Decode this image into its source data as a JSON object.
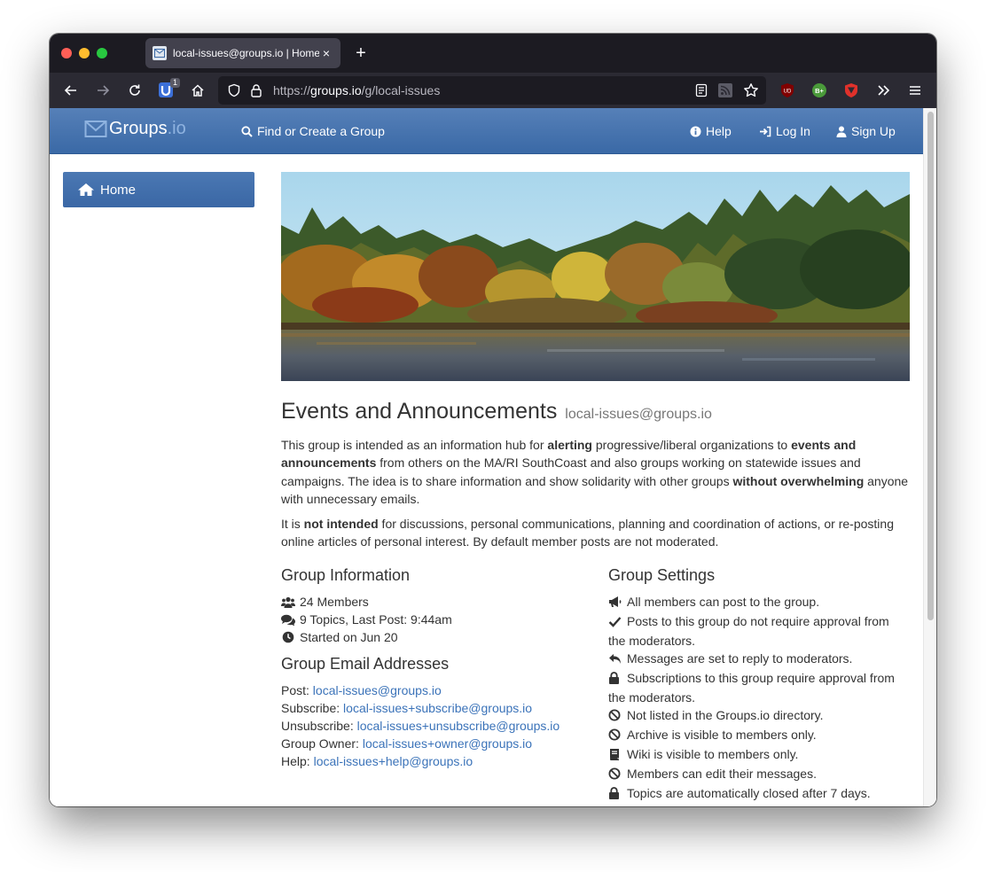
{
  "browser": {
    "tab_title": "local-issues@groups.io | Home",
    "new_tab": "+",
    "tab_close": "×",
    "url_scheme": "https://",
    "url_host": "groups.io",
    "url_path": "/g/local-issues",
    "ublock_count": "1",
    "ext_ub_label": "UD",
    "ext_green_label": "B+"
  },
  "site": {
    "brand_main": "Groups",
    "brand_suffix": ".io",
    "nav_find": "Find or Create a Group",
    "nav_help": "Help",
    "nav_login": "Log In",
    "nav_signup": "Sign Up",
    "sidebar_home": "Home"
  },
  "group": {
    "title": "Events and Announcements",
    "email": "local-issues@groups.io",
    "desc1": [
      {
        "t": "This group is intended as an information hub for ",
        "b": false
      },
      {
        "t": "alerting",
        "b": true
      },
      {
        "t": " progressive/liberal organizations to ",
        "b": false
      },
      {
        "t": "events and announcements",
        "b": true
      },
      {
        "t": " from others on the MA/RI SouthCoast and also groups working on statewide issues and campaigns. The idea is to share information and show solidarity with other groups ",
        "b": false
      },
      {
        "t": "without overwhelming",
        "b": true
      },
      {
        "t": " anyone with unnecessary emails.",
        "b": false
      }
    ],
    "desc2": [
      {
        "t": "It is ",
        "b": false
      },
      {
        "t": "not intended",
        "b": true
      },
      {
        "t": " for discussions, personal communications, planning and coordination of actions, or re-posting online articles of personal interest. By default member posts are not moderated.",
        "b": false
      }
    ]
  },
  "info": {
    "heading": "Group Information",
    "members": "24 Members",
    "topics": "9 Topics, Last Post: 9:44am",
    "started": "Started on Jun 20"
  },
  "emails": {
    "heading": "Group Email Addresses",
    "post_label": "Post:",
    "post": "local-issues@groups.io",
    "subscribe_label": "Subscribe:",
    "subscribe": "local-issues+subscribe@groups.io",
    "unsubscribe_label": "Unsubscribe:",
    "unsubscribe": "local-issues+unsubscribe@groups.io",
    "owner_label": "Group Owner:",
    "owner": "local-issues+owner@groups.io",
    "help_label": "Help:",
    "help": "local-issues+help@groups.io"
  },
  "settings": {
    "heading": "Group Settings",
    "items": [
      {
        "icon": "bullhorn-icon",
        "text": "All members can post to the group."
      },
      {
        "icon": "check-icon",
        "text": "Posts to this group do not require approval from the moderators."
      },
      {
        "icon": "reply-icon",
        "text": "Messages are set to reply to moderators."
      },
      {
        "icon": "lock-icon",
        "text": "Subscriptions to this group require approval from the moderators."
      },
      {
        "icon": "ban-icon",
        "text": "Not listed in the Groups.io directory."
      },
      {
        "icon": "ban-icon",
        "text": "Archive is visible to members only."
      },
      {
        "icon": "book-icon",
        "text": "Wiki is visible to members only."
      },
      {
        "icon": "ban-icon",
        "text": "Members can edit their messages."
      },
      {
        "icon": "lock-icon",
        "text": "Topics are automatically closed after 7 days."
      }
    ]
  },
  "colors": {
    "navbar": "#3a69a6",
    "link": "#3b73b9",
    "chrome_dark": "#1c1b22",
    "chrome_toolbar": "#2b2a33"
  }
}
